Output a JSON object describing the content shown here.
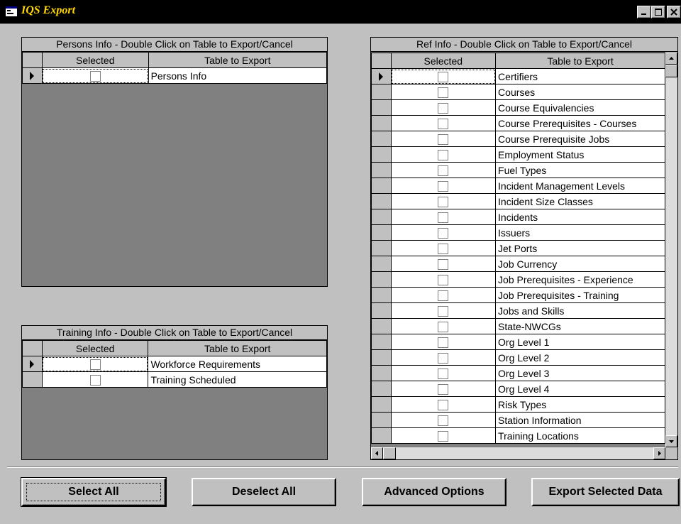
{
  "window": {
    "title": "IQS Export",
    "icon": "app-window-icon",
    "controls": [
      "minimize-icon",
      "maximize-icon",
      "close-icon"
    ]
  },
  "persons_grid": {
    "caption": "Persons Info - Double Click on Table to Export/Cancel",
    "headers": {
      "selected": "Selected",
      "table": "Table to Export"
    },
    "rows": [
      {
        "table": "Persons Info",
        "selected": false
      }
    ]
  },
  "training_grid": {
    "caption": "Training Info - Double Click on Table to Export/Cancel",
    "headers": {
      "selected": "Selected",
      "table": "Table to Export"
    },
    "rows": [
      {
        "table": "Workforce Requirements",
        "selected": false
      },
      {
        "table": "Training Scheduled",
        "selected": false
      }
    ]
  },
  "ref_grid": {
    "caption": "Ref Info - Double Click on Table to Export/Cancel",
    "headers": {
      "selected": "Selected",
      "table": "Table to Export"
    },
    "rows": [
      {
        "table": "Certifiers",
        "selected": false
      },
      {
        "table": "Courses",
        "selected": false
      },
      {
        "table": "Course Equivalencies",
        "selected": false
      },
      {
        "table": "Course Prerequisites - Courses",
        "selected": false
      },
      {
        "table": "Course Prerequisite Jobs",
        "selected": false
      },
      {
        "table": "Employment Status",
        "selected": false
      },
      {
        "table": "Fuel Types",
        "selected": false
      },
      {
        "table": "Incident Management Levels",
        "selected": false
      },
      {
        "table": "Incident Size Classes",
        "selected": false
      },
      {
        "table": "Incidents",
        "selected": false
      },
      {
        "table": "Issuers",
        "selected": false
      },
      {
        "table": "Jet Ports",
        "selected": false
      },
      {
        "table": "Job Currency",
        "selected": false
      },
      {
        "table": "Job Prerequisites - Experience",
        "selected": false
      },
      {
        "table": "Job Prerequisites - Training",
        "selected": false
      },
      {
        "table": "Jobs and Skills",
        "selected": false
      },
      {
        "table": "State-NWCGs",
        "selected": false
      },
      {
        "table": "Org Level 1",
        "selected": false
      },
      {
        "table": "Org Level 2",
        "selected": false
      },
      {
        "table": "Org Level 3",
        "selected": false
      },
      {
        "table": "Org Level 4",
        "selected": false
      },
      {
        "table": "Risk Types",
        "selected": false
      },
      {
        "table": "Station Information",
        "selected": false
      },
      {
        "table": "Training Locations",
        "selected": false
      }
    ]
  },
  "buttons": {
    "select_all": "Select All",
    "deselect_all": "Deselect All",
    "advanced_options": "Advanced Options",
    "export_selected": "Export Selected Data"
  },
  "colors": {
    "face": "#c0c0c0",
    "grid_background": "#808080",
    "title_text": "#ffd700",
    "titlebar": "#000000"
  }
}
